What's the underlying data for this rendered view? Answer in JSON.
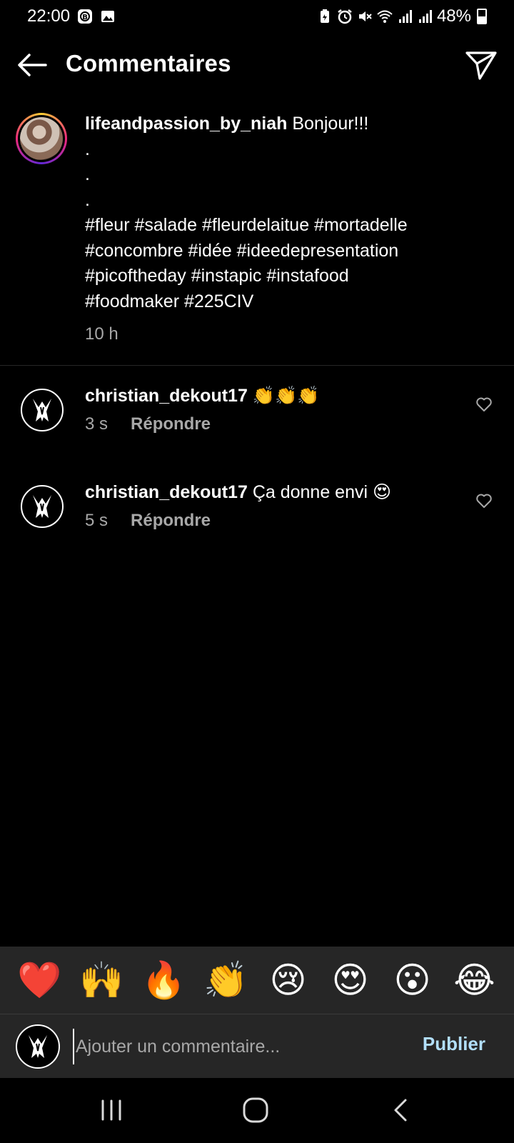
{
  "status_bar": {
    "time": "22:00",
    "battery": "48%",
    "left_icons": [
      "b-badge-icon",
      "image-icon"
    ],
    "right_icons": [
      "battery-saver-icon",
      "alarm-icon",
      "mute-icon",
      "wifi-icon",
      "signal-icon",
      "signal-icon"
    ]
  },
  "header": {
    "title": "Commentaires",
    "back_icon": "arrow-left-icon",
    "share_icon": "paper-plane-icon"
  },
  "caption": {
    "username": "lifeandpassion_by_niah",
    "text_first": "Bonjour!!!",
    "lines": [
      ".",
      ".",
      ".",
      "#fleur #salade #fleurdelaitue #mortadelle",
      "#concombre #idée #ideedepresentation",
      "#picoftheday #instapic #instafood",
      "#foodmaker #225CIV"
    ],
    "time": "10 h"
  },
  "comments": [
    {
      "username": "christian_dekout17",
      "text": "👏👏👏",
      "time": "3 s",
      "reply": "Répondre"
    },
    {
      "username": "christian_dekout17",
      "text": "Ça donne envi 😍",
      "time": "5 s",
      "reply": "Répondre"
    }
  ],
  "emoji_bar": [
    "❤️",
    "🙌",
    "🔥",
    "👏",
    "😢",
    "😍",
    "😮",
    "😂"
  ],
  "input": {
    "placeholder": "Ajouter un commentaire...",
    "value": "",
    "publish": "Publier"
  },
  "colors": {
    "background": "#000000",
    "panel": "#262626",
    "secondary_text": "#a8a8a8",
    "publish_link": "#b2dffc"
  }
}
